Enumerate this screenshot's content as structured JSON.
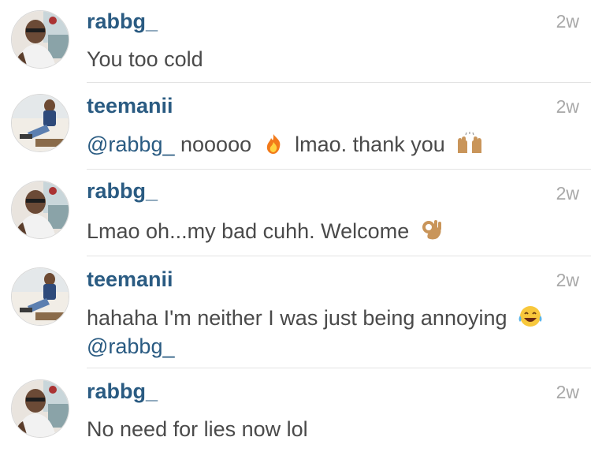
{
  "comments": [
    {
      "username": "rabbg_",
      "time": "2w",
      "text": "You too cold"
    },
    {
      "username": "teemanii",
      "time": "2w",
      "mention": "@rabbg_",
      "text_before": "nooooo",
      "emoji1": "fire-emoji",
      "text_after": "lmao. thank you",
      "emoji2": "raising-hands-emoji"
    },
    {
      "username": "rabbg_",
      "time": "2w",
      "text": "Lmao oh...my bad cuhh. Welcome",
      "emoji": "ok-hand-emoji"
    },
    {
      "username": "teemanii",
      "time": "2w",
      "text": "hahaha I'm neither I was just being annoying",
      "emoji": "tears-of-joy-emoji",
      "mention": "@rabbg_"
    },
    {
      "username": "rabbg_",
      "time": "2w",
      "text": "No need for lies now lol"
    }
  ],
  "colors": {
    "username": "#2a5b82",
    "mention": "#2a5b82",
    "body": "#4a4a4a",
    "timestamp": "#a8a8a8",
    "divider": "#e3e3e3"
  }
}
